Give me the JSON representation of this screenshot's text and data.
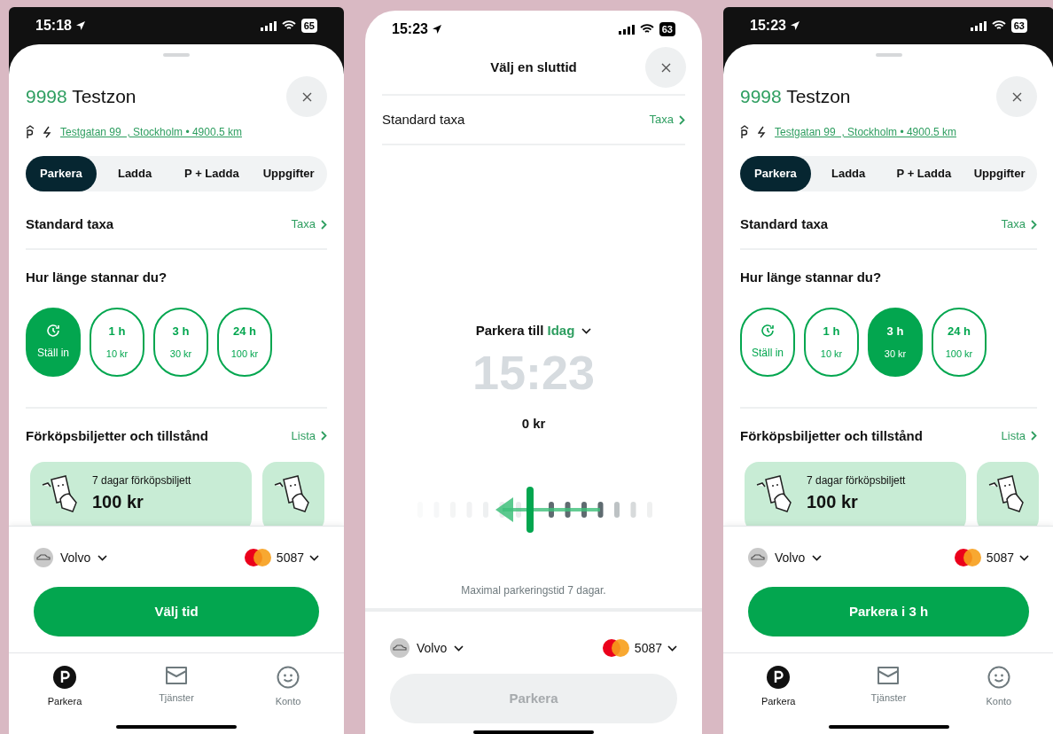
{
  "phones": [
    {
      "kind": "sheet",
      "status_bar": {
        "time": "15:18",
        "battery": "65"
      },
      "zone_number": "9998",
      "zone_name": "Testzon",
      "address": "Testgatan 99  , Stockholm • 4900.5 km",
      "tabs": [
        {
          "label": "Parkera",
          "selected": true
        },
        {
          "label": "Ladda",
          "selected": false
        },
        {
          "label": "P + Ladda",
          "selected": false
        },
        {
          "label": "Uppgifter",
          "selected": false
        }
      ],
      "rate": {
        "label": "Standard taxa",
        "link": "Taxa"
      },
      "duration_title": "Hur länge stannar du?",
      "durations": [
        {
          "kind": "custom",
          "label": "Ställ in",
          "selected": true
        },
        {
          "kind": "preset",
          "label": "1 h",
          "price": "10 kr",
          "selected": false
        },
        {
          "kind": "preset",
          "label": "3 h",
          "price": "30 kr",
          "selected": false
        },
        {
          "kind": "preset",
          "label": "24 h",
          "price": "100 kr",
          "selected": false
        }
      ],
      "tickets_title": "Förköpsbiljetter och tillstånd",
      "tickets_link": "Lista",
      "tickets": [
        {
          "name": "7 dagar förköpsbiljett",
          "price": "100 kr"
        }
      ],
      "vehicle": "Volvo",
      "card": "5087",
      "action": {
        "label": "Välj tid",
        "disabled": false
      },
      "nav": [
        {
          "label": "Parkera",
          "selected": true
        },
        {
          "label": "Tjänster",
          "selected": false
        },
        {
          "label": "Konto",
          "selected": false
        }
      ]
    },
    {
      "kind": "picker",
      "status_bar": {
        "time": "15:23",
        "battery": "63"
      },
      "title": "Välj en sluttid",
      "rate": {
        "label": "Standard taxa",
        "link": "Taxa"
      },
      "park_until": "Parkera till",
      "day": "Idag",
      "time": "15:23",
      "cost": "0 kr",
      "note": "Maximal parkeringstid 7 dagar.",
      "vehicle": "Volvo",
      "card": "5087",
      "action": {
        "label": "Parkera",
        "disabled": true
      }
    },
    {
      "kind": "sheet",
      "status_bar": {
        "time": "15:23",
        "battery": "63"
      },
      "zone_number": "9998",
      "zone_name": "Testzon",
      "address": "Testgatan 99  , Stockholm • 4900.5 km",
      "tabs": [
        {
          "label": "Parkera",
          "selected": true
        },
        {
          "label": "Ladda",
          "selected": false
        },
        {
          "label": "P + Ladda",
          "selected": false
        },
        {
          "label": "Uppgifter",
          "selected": false
        }
      ],
      "rate": {
        "label": "Standard taxa",
        "link": "Taxa"
      },
      "duration_title": "Hur länge stannar du?",
      "durations": [
        {
          "kind": "custom",
          "label": "Ställ in",
          "selected": false
        },
        {
          "kind": "preset",
          "label": "1 h",
          "price": "10 kr",
          "selected": false
        },
        {
          "kind": "preset",
          "label": "3 h",
          "price": "30 kr",
          "selected": true
        },
        {
          "kind": "preset",
          "label": "24 h",
          "price": "100 kr",
          "selected": false
        }
      ],
      "tickets_title": "Förköpsbiljetter och tillstånd",
      "tickets_link": "Lista",
      "tickets": [
        {
          "name": "7 dagar förköpsbiljett",
          "price": "100 kr"
        }
      ],
      "vehicle": "Volvo",
      "card": "5087",
      "action": {
        "label": "Parkera i 3 h",
        "disabled": false
      },
      "nav": [
        {
          "label": "Parkera",
          "selected": true
        },
        {
          "label": "Tjänster",
          "selected": false
        },
        {
          "label": "Konto",
          "selected": false
        }
      ]
    }
  ]
}
